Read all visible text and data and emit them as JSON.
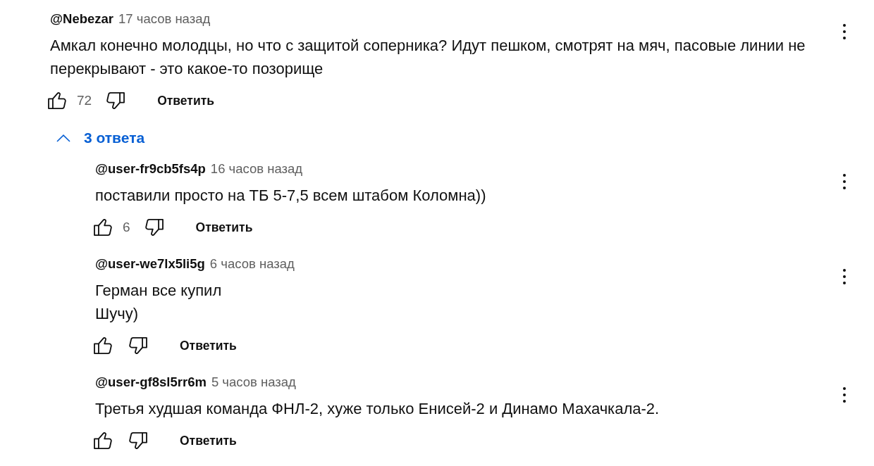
{
  "comment": {
    "author": "@Nebezar",
    "time": "17 часов назад",
    "text": "Амкал конечно молодцы, но что с защитой соперника? Идут пешком, смотрят на мяч, пасовые линии не перекрывают - это какое-то позорище",
    "likes": "72",
    "reply_action": "Ответить",
    "replies_toggle": {
      "label": "3 ответа",
      "expanded": true
    },
    "replies": [
      {
        "author": "@user-fr9cb5fs4p",
        "time": "16 часов назад",
        "text": "поставили просто на ТБ 5-7,5 всем штабом Коломна))",
        "likes": "6",
        "reply_action": "Ответить"
      },
      {
        "author": "@user-we7lx5li5g",
        "time": "6 часов назад",
        "text": "Герман все купил\nШучу)",
        "reply_action": "Ответить"
      },
      {
        "author": "@user-gf8sl5rr6m",
        "time": "5 часов назад",
        "text": "Третья худшая команда ФНЛ-2, хуже только Енисей-2 и Динамо Махачкала-2.",
        "reply_action": "Ответить"
      }
    ]
  }
}
